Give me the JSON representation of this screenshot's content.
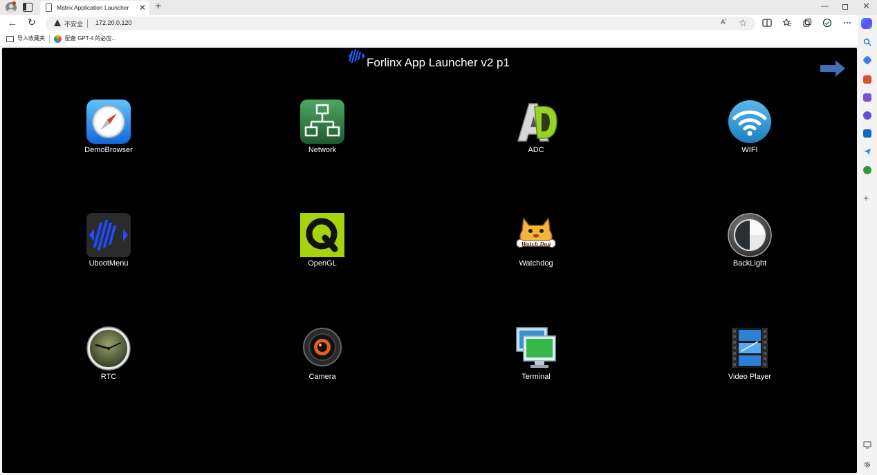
{
  "browser": {
    "tab_title": "Matrix Application Launcher",
    "tab_close": "✕",
    "new_tab": "+",
    "window_min": "—",
    "window_close": "✕",
    "back": "←",
    "reload": "↻",
    "security_label": "不安全",
    "url": "172.20.0.120",
    "read_aloud": "Aʼ",
    "favorite": "☆",
    "bookmarks": [
      {
        "label": "导入收藏夹"
      },
      {
        "label": "配备 GPT-4 的必应..."
      }
    ]
  },
  "launcher": {
    "title": "Forlinx App Launcher v2 p1",
    "apps": [
      {
        "label": "DemoBrowser",
        "icon": "safari-compass-icon"
      },
      {
        "label": "Network",
        "icon": "network-icon"
      },
      {
        "label": "ADC",
        "icon": "adc-icon"
      },
      {
        "label": "WIFI",
        "icon": "wifi-icon"
      },
      {
        "label": "UbootMenu",
        "icon": "uboot-icon"
      },
      {
        "label": "OpenGL",
        "icon": "qt-icon"
      },
      {
        "label": "Watchdog",
        "icon": "watchdog-icon"
      },
      {
        "label": "BackLight",
        "icon": "backlight-icon"
      },
      {
        "label": "RTC",
        "icon": "clock-icon"
      },
      {
        "label": "Camera",
        "icon": "camera-icon"
      },
      {
        "label": "Terminal",
        "icon": "terminal-icon"
      },
      {
        "label": "Video Player",
        "icon": "video-icon"
      }
    ],
    "watchdog_badge": "Watch Dog"
  },
  "colors": {
    "launcher_bg": "#000000",
    "arrow_blue": "#3f6fb5",
    "opengl_green": "#a7d20e",
    "logo_blue": "#1f5fff"
  }
}
